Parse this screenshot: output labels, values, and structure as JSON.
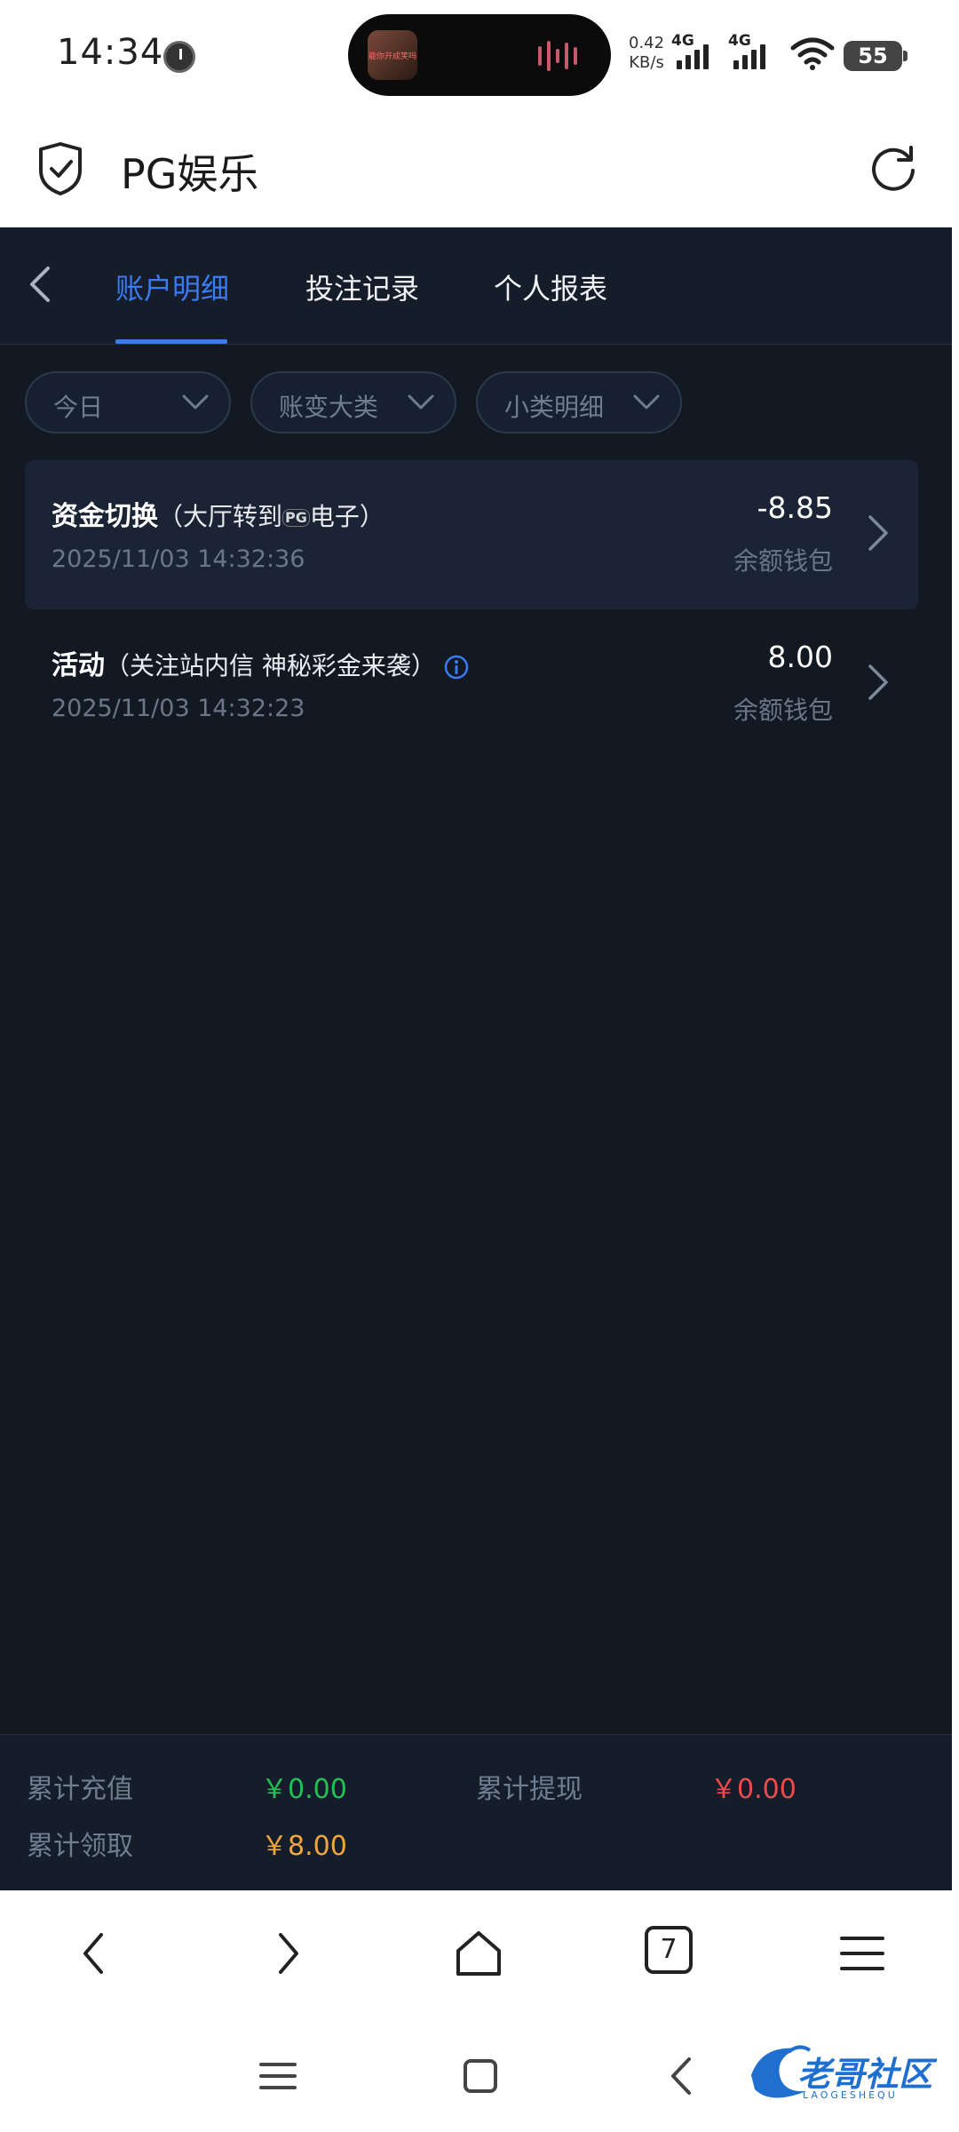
{
  "status_bar": {
    "time": "14:34",
    "net_speed": "0.42",
    "net_unit": "KB/s",
    "sig1": "4G",
    "sig2": "4G",
    "battery": "55",
    "island_text": "能你开成笑吗"
  },
  "app": {
    "title": "PG娱乐"
  },
  "tabs": [
    {
      "label": "账户明细",
      "active": true
    },
    {
      "label": "投注记录",
      "active": false
    },
    {
      "label": "个人报表",
      "active": false
    }
  ],
  "filters": [
    {
      "label": "今日"
    },
    {
      "label": "账变大类"
    },
    {
      "label": "小类明细"
    }
  ],
  "records": [
    {
      "title": "资金切换",
      "detail_before": "（大厅转到",
      "detail_logo": "PG",
      "detail_after": "电子）",
      "datetime": "2025/11/03 14:32:36",
      "amount": "-8.85",
      "wallet": "余额钱包"
    },
    {
      "title": "活动",
      "detail": "（关注站内信 神秘彩金来袭）",
      "datetime": "2025/11/03 14:32:23",
      "amount": "8.00",
      "wallet": "余额钱包"
    }
  ],
  "summary": {
    "deposit_label": "累计充值",
    "deposit_value": "￥0.00",
    "withdraw_label": "累计提现",
    "withdraw_value": "￥0.00",
    "claim_label": "累计领取",
    "claim_value": "￥8.00",
    "colors": {
      "deposit": "#22c155",
      "withdraw": "#ef4b4b",
      "claim": "#f2a53b"
    }
  },
  "browser": {
    "tab_count": "7"
  },
  "watermark": {
    "text": "老哥社区",
    "sub": "LAOGESHEQU"
  },
  "icons": [
    "shield-check-icon",
    "refresh-icon",
    "back-chevron-icon",
    "chevron-down-icon",
    "chevron-right-icon",
    "info-icon",
    "home-icon",
    "menu-icon",
    "square-icon"
  ]
}
